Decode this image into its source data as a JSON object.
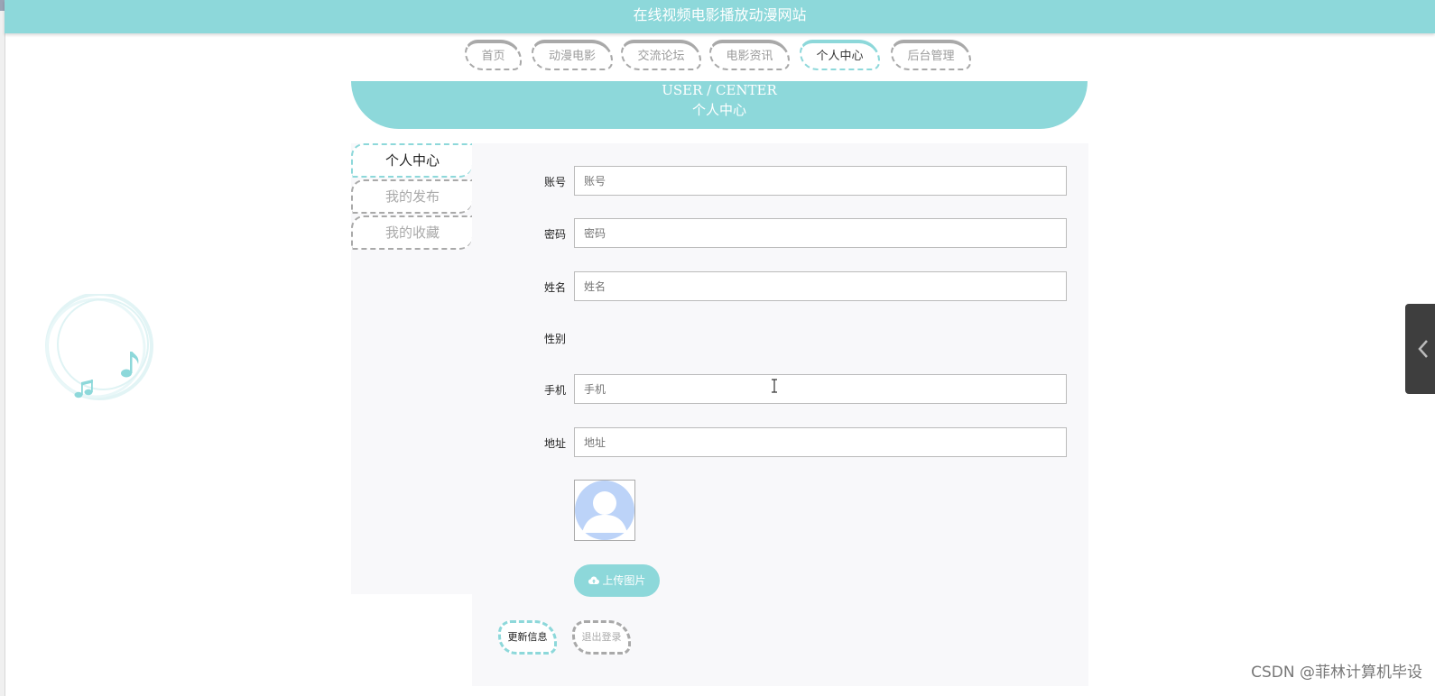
{
  "site_title": "在线视频电影播放动漫网站",
  "nav": {
    "items": [
      {
        "label": "首页"
      },
      {
        "label": "动漫电影"
      },
      {
        "label": "交流论坛"
      },
      {
        "label": "电影资讯"
      },
      {
        "label": "个人中心"
      },
      {
        "label": "后台管理"
      }
    ],
    "active": "个人中心"
  },
  "banner": {
    "title_en": "USER / CENTER",
    "title_cn": "个人中心"
  },
  "sidebar": {
    "items": [
      {
        "label": "个人中心"
      },
      {
        "label": "我的发布"
      },
      {
        "label": "我的收藏"
      }
    ],
    "active": "个人中心"
  },
  "form": {
    "account": {
      "label": "账号",
      "placeholder": "账号"
    },
    "password": {
      "label": "密码",
      "placeholder": "密码"
    },
    "name": {
      "label": "姓名",
      "placeholder": "姓名"
    },
    "gender": {
      "label": "性别"
    },
    "phone": {
      "label": "手机",
      "placeholder": "手机"
    },
    "address": {
      "label": "地址",
      "placeholder": "地址"
    }
  },
  "upload_label": "上传图片",
  "actions": {
    "update": "更新信息",
    "logout": "退出登录"
  },
  "watermark": "CSDN @菲林计算机毕设",
  "colors": {
    "accent": "#8dd8da",
    "dashed_gray": "#a9a9a9",
    "panel_bg": "#f8f8fa",
    "avatar_blue": "#bcd3f8"
  },
  "icons": [
    "music-notes-icon",
    "cloud-upload-icon",
    "chevron-left-icon",
    "avatar-placeholder-icon"
  ]
}
